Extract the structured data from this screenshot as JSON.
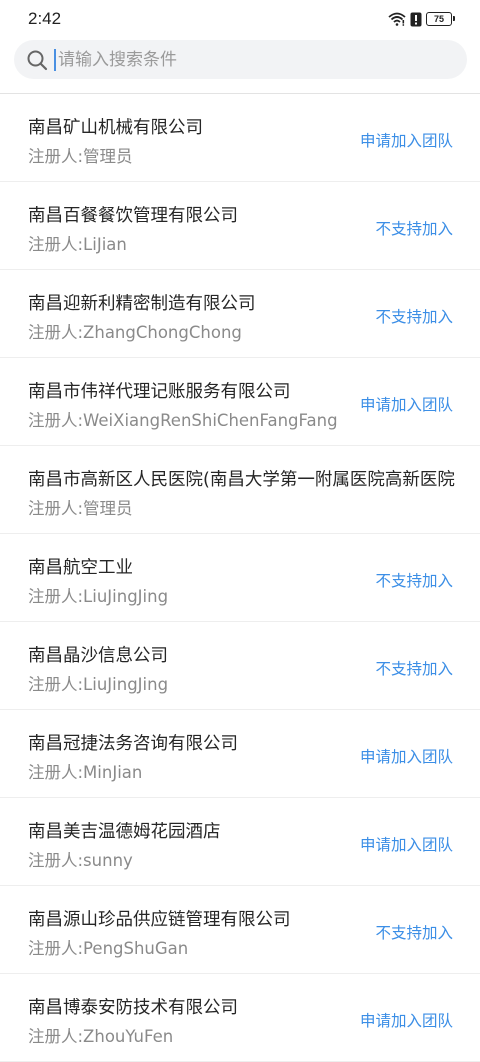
{
  "status_bar": {
    "time": "2:42",
    "battery": "75",
    "icons": [
      "wifi-icon",
      "alert-icon",
      "battery-icon"
    ]
  },
  "search": {
    "placeholder": "请输入搜索条件",
    "value": ""
  },
  "colors": {
    "action": "#3b8ee6",
    "search_bg": "#f2f3f5"
  },
  "companies": [
    {
      "name": "南昌矿山机械有限公司",
      "registrant": "注册人:管理员",
      "action": "申请加入团队"
    },
    {
      "name": "南昌百餐餐饮管理有限公司",
      "registrant": "注册人:LiJian",
      "action": "不支持加入"
    },
    {
      "name": "南昌迎新利精密制造有限公司",
      "registrant": "注册人:ZhangChongChong",
      "action": "不支持加入"
    },
    {
      "name": "南昌市伟祥代理记账服务有限公司",
      "registrant": "注册人:WeiXiangRenShiChenFangFang",
      "action": "申请加入团队"
    },
    {
      "name": "南昌市高新区人民医院(南昌大学第一附属医院高新医院",
      "registrant": "注册人:管理员",
      "action": ""
    },
    {
      "name": "南昌航空工业",
      "registrant": "注册人:LiuJingJing",
      "action": "不支持加入"
    },
    {
      "name": "南昌晶沙信息公司",
      "registrant": "注册人:LiuJingJing",
      "action": "不支持加入"
    },
    {
      "name": "南昌冠捷法务咨询有限公司",
      "registrant": "注册人:MinJian",
      "action": "申请加入团队"
    },
    {
      "name": "南昌美吉温德姆花园酒店",
      "registrant": "注册人:sunny",
      "action": "申请加入团队"
    },
    {
      "name": "南昌源山珍品供应链管理有限公司",
      "registrant": "注册人:PengShuGan",
      "action": "不支持加入"
    },
    {
      "name": "南昌博泰安防技术有限公司",
      "registrant": "注册人:ZhouYuFen",
      "action": "申请加入团队"
    }
  ]
}
